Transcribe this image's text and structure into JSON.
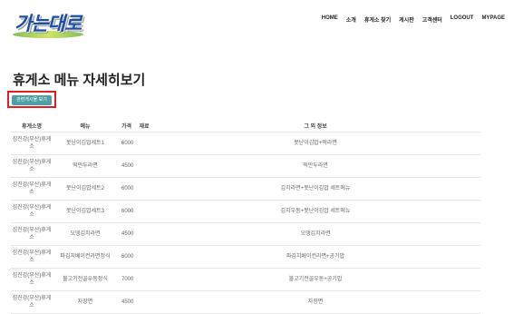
{
  "brand": {
    "logo_text": "가는대로"
  },
  "nav": [
    "HOME",
    "소개",
    "휴게소 찾기",
    "게시판",
    "고객센터",
    "LOGOUT",
    "MYPAGE"
  ],
  "page_title": "휴게소 메뉴 자세히보기",
  "related_button": "관련게시물 보기",
  "table": {
    "headers": {
      "store": "휴게소명",
      "menu": "메뉴",
      "price": "가격",
      "ingredient": "재료",
      "other": "그 외 정보"
    },
    "rows": [
      {
        "store": "섬진강(부산)휴게소",
        "menu": "못난이김밥세트1",
        "price": "6000",
        "ingredient": "",
        "other": "못난이김밥+떡라면"
      },
      {
        "store": "섬진강(부산)휴게소",
        "menu": "떡만두라면",
        "price": "4500",
        "ingredient": "",
        "other": "떡만두라면"
      },
      {
        "store": "섬진강(부산)휴게소",
        "menu": "못난이김밥세트2",
        "price": "6000",
        "ingredient": "",
        "other": "김치라면+못난이김밥 세트메뉴"
      },
      {
        "store": "섬진강(부산)휴게소",
        "menu": "못난이김밥세트3",
        "price": "6000",
        "ingredient": "",
        "other": "김치우동+못난이김밥 세트메뉴"
      },
      {
        "store": "섬진강(부산)휴게소",
        "menu": "오뎅김치라면",
        "price": "4500",
        "ingredient": "",
        "other": "오뎅김치라면"
      },
      {
        "store": "섬진강(부산)휴게소",
        "menu": "파김치베이컨라면정식",
        "price": "6000",
        "ingredient": "",
        "other": "파김치베이컨라면+공기밥"
      },
      {
        "store": "섬진강(부산)휴게소",
        "menu": "불고기전골우동정식",
        "price": "7000",
        "ingredient": "",
        "other": "불고기전골우동+공기밥"
      },
      {
        "store": "섬진강(부산)휴게소",
        "menu": "자장면",
        "price": "4500",
        "ingredient": "",
        "other": "자장면"
      }
    ]
  }
}
